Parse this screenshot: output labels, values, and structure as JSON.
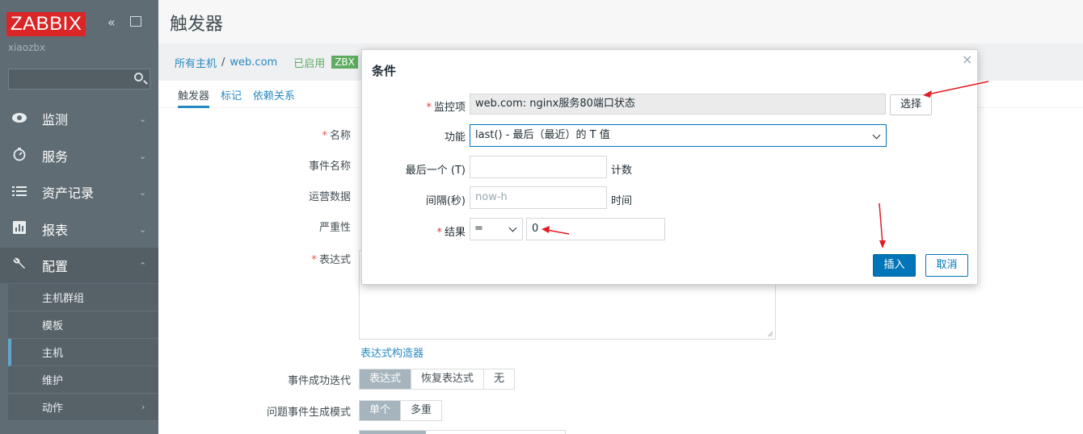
{
  "sidebar": {
    "logo": "ZABBIX",
    "collapse_glyph": "«",
    "username": "xiaozbx",
    "menu": [
      {
        "label": "监测",
        "icon": "eye-icon"
      },
      {
        "label": "服务",
        "icon": "clock-icon"
      },
      {
        "label": "资产记录",
        "icon": "list-icon"
      },
      {
        "label": "报表",
        "icon": "bar-chart-icon"
      },
      {
        "label": "配置",
        "icon": "wrench-icon"
      }
    ],
    "submenu": [
      "主机群组",
      "模板",
      "主机",
      "维护",
      "动作"
    ]
  },
  "header": {
    "title": "触发器"
  },
  "breadcrumb": {
    "all_hosts": "所有主机",
    "separator": "/",
    "host": "web.com",
    "status": "已启用",
    "badge": "ZBX"
  },
  "tabs": [
    "触发器",
    "标记",
    "依赖关系"
  ],
  "form": {
    "name_label": "名称",
    "event_name_label": "事件名称",
    "opdata_label": "运营数据",
    "severity_label": "严重性",
    "expression_label": "表达式",
    "expr_constructor_link": "表达式构造器",
    "ok_event_label": "事件成功迭代",
    "ok_event_options": [
      "表达式",
      "恢复表达式",
      "无"
    ],
    "gen_mode_label": "问题事件生成模式",
    "gen_mode_options": [
      "单个",
      "多重"
    ]
  },
  "dialog": {
    "title": "条件",
    "close_glyph": "×",
    "item_label": "监控项",
    "item_value": "web.com: nginx服务80端口状态",
    "choose_button": "选择",
    "function_label": "功能",
    "function_value": "last() - 最后（最近）的 T 值",
    "last_label": "最后一个 (T)",
    "last_value": "",
    "last_unit": "计数",
    "interval_label": "间隔(秒)",
    "interval_placeholder": "now-h",
    "interval_unit": "时间",
    "result_label": "结果",
    "operator_value": "=",
    "result_value": "0",
    "insert_button": "插入",
    "cancel_button": "取消"
  },
  "colors": {
    "sidebar_bg": "#43535c",
    "logo_bg": "#d40000",
    "accent": "#0275b8",
    "annotation_arrow": "#e31b23"
  }
}
